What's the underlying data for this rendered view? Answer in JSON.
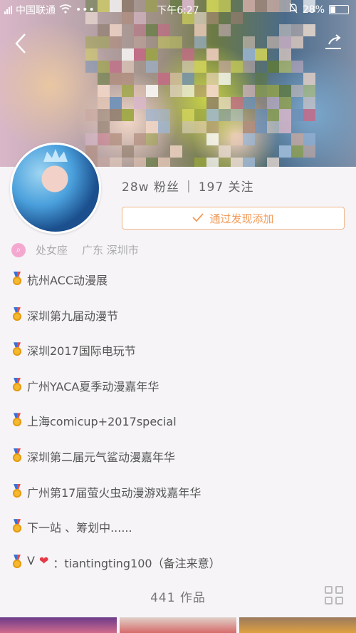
{
  "status_bar": {
    "carrier": "中国联通",
    "time": "下午6:27",
    "battery": "28%"
  },
  "profile": {
    "followers": "28w 粉丝",
    "separator": "|",
    "following": "197 关注",
    "add_button": "通过发现添加",
    "zodiac": "处女座",
    "location": "广东 深圳市"
  },
  "bio": [
    {
      "text": "杭州ACC动漫展"
    },
    {
      "text": "深圳第九届动漫节"
    },
    {
      "text": "深圳2017国际电玩节"
    },
    {
      "text": "广州YACA夏季动漫嘉年华"
    },
    {
      "text": "上海comicup+2017special"
    },
    {
      "text": "深圳第二届元气鲨动漫嘉年华"
    },
    {
      "text": "广州第17届萤火虫动漫游戏嘉年华"
    },
    {
      "text": "下一站 、筹划中......"
    },
    {
      "prefix": "V",
      "text": "：tiantingting100（备注来意）"
    }
  ],
  "works_label": "441 作品",
  "colors": {
    "accent": "#f29a58",
    "pin": "#f4a8d0"
  }
}
